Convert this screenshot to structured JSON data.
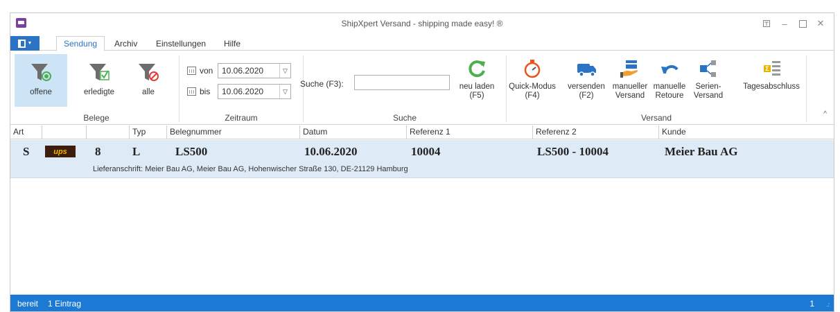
{
  "window": {
    "title": "ShipXpert Versand - shipping made easy! ®"
  },
  "tabs": [
    "Sendung",
    "Archiv",
    "Einstellungen",
    "Hilfe"
  ],
  "ribbon": {
    "belege": {
      "label": "Belege",
      "offene": "offene",
      "erledigte": "erledigte",
      "alle": "alle"
    },
    "zeitraum": {
      "label": "Zeitraum",
      "von_label": "von",
      "von_value": "10.06.2020",
      "bis_label": "bis",
      "bis_value": "10.06.2020"
    },
    "suche": {
      "label": "Suche",
      "field_label": "Suche (F3):",
      "field_value": "",
      "reload_line1": "neu laden",
      "reload_line2": "(F5)"
    },
    "versand": {
      "label": "Versand",
      "quick1": "Quick-Modus",
      "quick2": "(F4)",
      "send1": "versenden",
      "send2": "(F2)",
      "manual1": "manueller",
      "manual2": "Versand",
      "retoure1": "manuelle",
      "retoure2": "Retoure",
      "serien1": "Serien-",
      "serien2": "Versand",
      "tages": "Tagesabschluss"
    }
  },
  "table": {
    "columns": [
      "Art",
      "",
      "",
      "Typ",
      "Belegnummer",
      "Datum",
      "Referenz 1",
      "Referenz 2",
      "Kunde"
    ],
    "rows": [
      {
        "art": "S",
        "carrier": "ups",
        "count": "8",
        "typ": "L",
        "belegnummer": "LS500",
        "datum": "10.06.2020",
        "referenz1": "10004",
        "referenz2": "LS500 - 10004",
        "kunde": "Meier Bau AG",
        "address": "Lieferanschrift: Meier Bau AG, Meier Bau AG, Hohenwischer Straße 130, DE-21129 Hamburg"
      }
    ]
  },
  "status": {
    "state": "bereit",
    "count": "1 Eintrag",
    "page": "1"
  },
  "colors": {
    "accent": "#1c7ad4",
    "selected": "#deebf7",
    "green": "#4caf50",
    "red": "#e53935"
  }
}
